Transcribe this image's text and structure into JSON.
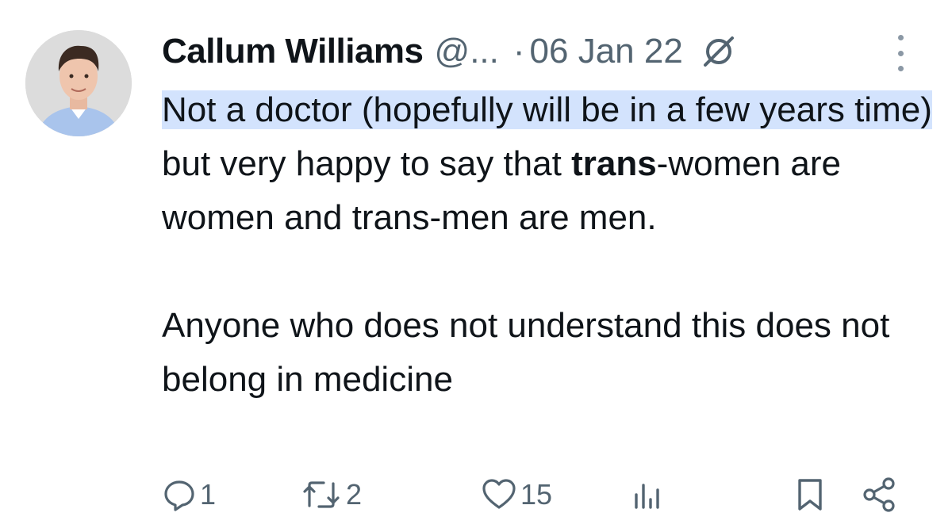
{
  "tweet": {
    "author": {
      "display_name": "Callum Williams",
      "handle": "@...",
      "avatar_icon": "profile-photo"
    },
    "separator": "·",
    "date": "06 Jan 22",
    "grok_icon": "grok-icon",
    "more_icon": "vertical-ellipsis-icon",
    "body": {
      "line1_highlighted": "Not a doctor (hopefully will be in a few years time)",
      "line1_rest": " but very happy to say that ",
      "bold_word": "trans",
      "line1_tail": "-women are women and trans-men are men.",
      "paragraph2": "Anyone who does not understand this does not belong in medicine"
    },
    "actions": {
      "reply": {
        "icon": "reply-icon",
        "count": "1"
      },
      "retweet": {
        "icon": "retweet-icon",
        "count": "2"
      },
      "like": {
        "icon": "heart-icon",
        "count": "15"
      },
      "views": {
        "icon": "views-icon",
        "count": ""
      },
      "bookmark": {
        "icon": "bookmark-icon"
      },
      "share": {
        "icon": "share-icon"
      }
    },
    "colors": {
      "text": "#0f1419",
      "secondary": "#536471",
      "highlight": "#d3e3fd"
    }
  }
}
